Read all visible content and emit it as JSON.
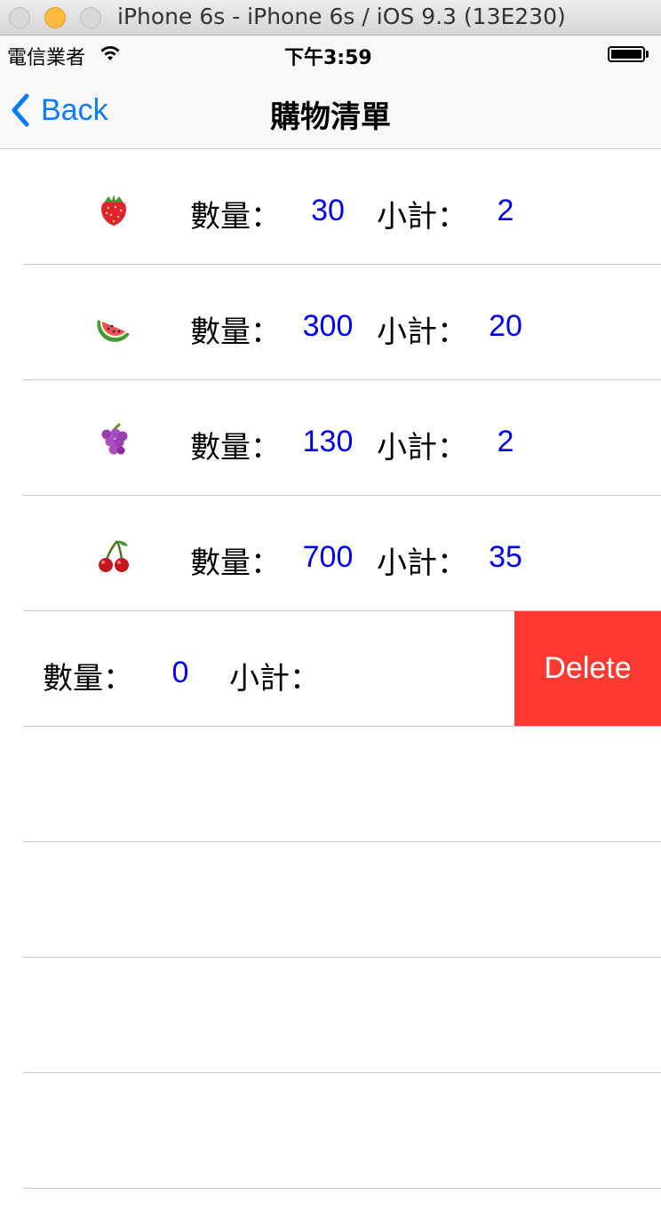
{
  "window": {
    "title": "iPhone 6s - iPhone 6s / iOS 9.3 (13E230)"
  },
  "status_bar": {
    "carrier": "電信業者",
    "time": "下午3:59",
    "icons": [
      "wifi-icon",
      "battery-icon"
    ]
  },
  "nav": {
    "back_label": "Back",
    "title": "購物清單"
  },
  "rows": [
    {
      "fruit_icon": "strawberry-icon",
      "qty_label": "數量：",
      "qty": "30",
      "sub_label": "小計：",
      "subtotal": "2"
    },
    {
      "fruit_icon": "watermelon-icon",
      "qty_label": "數量：",
      "qty": "300",
      "sub_label": "小計：",
      "subtotal": "20"
    },
    {
      "fruit_icon": "grapes-icon",
      "qty_label": "數量：",
      "qty": "130",
      "sub_label": "小計：",
      "subtotal": "2"
    },
    {
      "fruit_icon": "cherries-icon",
      "qty_label": "數量：",
      "qty": "700",
      "sub_label": "小計：",
      "subtotal": "35"
    },
    {
      "qty_label": "數量：",
      "qty": "0",
      "sub_label": "小計：",
      "delete_label": "Delete"
    }
  ],
  "colors": {
    "accent": "#0a7aff",
    "value_text": "#0000ee",
    "delete_bg": "#fe3a30",
    "separator": "#c8c7cc"
  }
}
